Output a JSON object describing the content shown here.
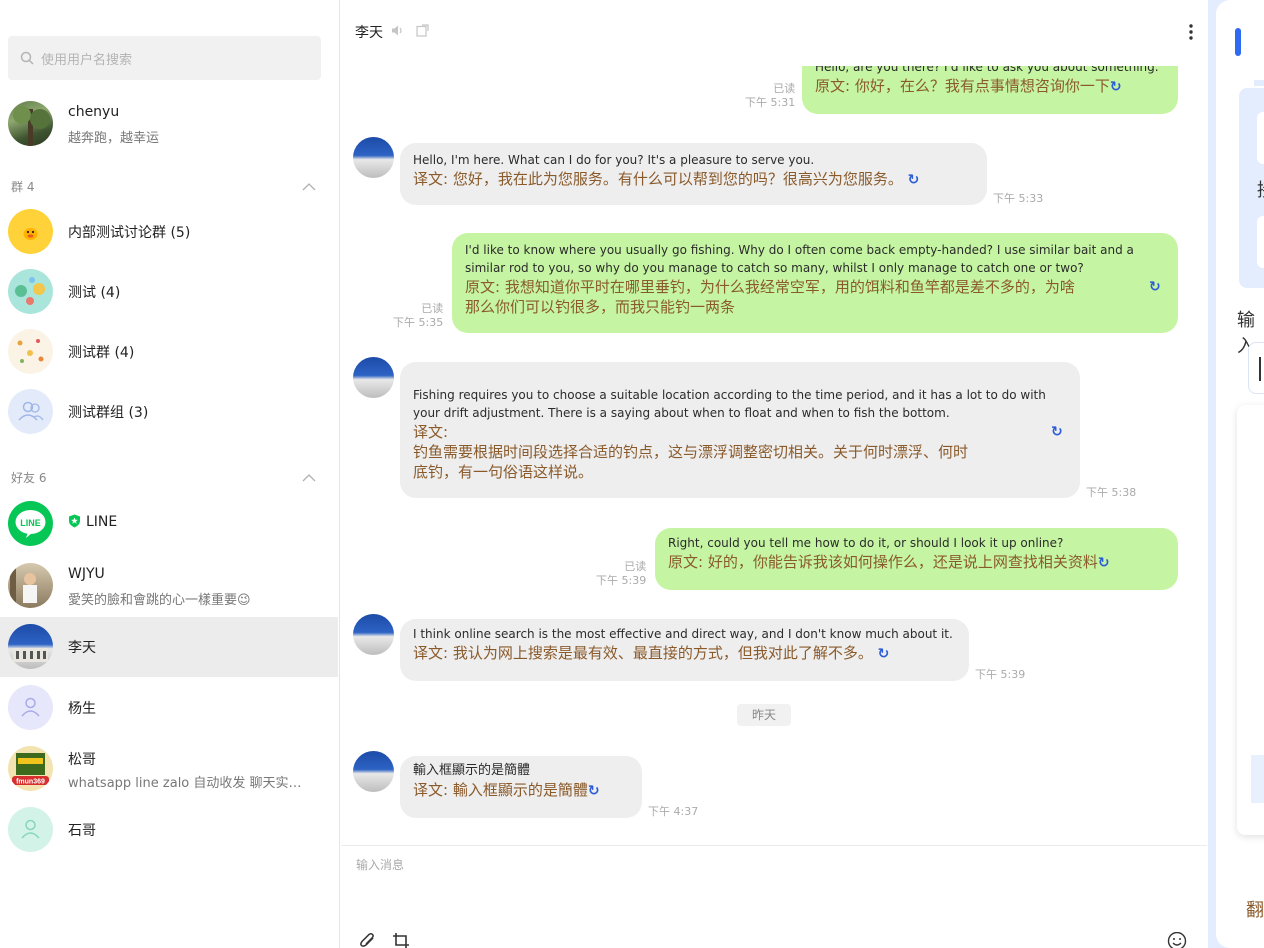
{
  "sidebar": {
    "search_placeholder": "使用用户名搜索",
    "top_contact": {
      "name": "chenyu",
      "status": "越奔跑，越幸运"
    },
    "groups_header": "群 4",
    "groups": [
      {
        "name": "内部测试讨论群 (5)"
      },
      {
        "name": "测试 (4)"
      },
      {
        "name": "测试群 (4)"
      },
      {
        "name": "测试群组 (3)"
      }
    ],
    "friends_header": "好友 6",
    "friends": [
      {
        "name": "LINE",
        "status": ""
      },
      {
        "name": "WJYU",
        "status": "愛笑的臉和會跳的心一樣重要😉"
      },
      {
        "name": "李天",
        "status": ""
      },
      {
        "name": "杨生",
        "status": ""
      },
      {
        "name": "松哥",
        "status": "whatsapp line zalo 自动收发 聊天实…"
      },
      {
        "name": "石哥",
        "status": ""
      }
    ],
    "avatar_text_songge": "fmun369"
  },
  "chat": {
    "title": "李天",
    "messages": [
      {
        "dir": "out",
        "en": "Hello, are you there? I'd like to ask you about something.",
        "tr": "原文: 你好，在么？我有点事情想咨询你一下",
        "read": "已读",
        "time": "下午 5:31"
      },
      {
        "dir": "in",
        "en": "Hello, I'm here. What can I do for you? It's a pleasure to serve you.",
        "tr": "译文: 您好，我在此为您服务。有什么可以帮到您的吗？很高兴为您服务。",
        "time": "下午 5:33"
      },
      {
        "dir": "out",
        "en1": "I'd like to know where you usually go fishing. Why do I often come back empty-handed? I use similar bait and a",
        "en2": "similar rod to you, so why do you manage to catch so many, whilst I only manage to catch one or two?",
        "tr1": "原文: 我想知道你平时在哪里垂钓，为什么我经常空军，用的饵料和鱼竿都是差不多的，为啥",
        "tr2": "那么你们可以钓很多，而我只能钓一两条",
        "read": "已读",
        "time": "下午 5:35"
      },
      {
        "dir": "in",
        "en1": "Fishing requires you to choose a suitable location according to the time period, and it has a lot to do with",
        "en2": "your drift adjustment. There is a saying about when to float and when to fish the bottom.",
        "tr0": "译文:",
        "tr1": "钓鱼需要根据时间段选择合适的钓点，这与漂浮调整密切相关。关于何时漂浮、何时",
        "tr2": "底钓，有一句俗语这样说。",
        "time": "下午 5:38"
      },
      {
        "dir": "out",
        "en": "Right, could you tell me how to do it, or should I look it up online?",
        "tr": "原文: 好的，你能告诉我该如何操作么，还是说上网查找相关资料",
        "read": "已读",
        "time": "下午 5:39"
      },
      {
        "dir": "in",
        "en": "I think online search is the most effective and direct way, and I don't know much about it.",
        "tr": "译文: 我认为网上搜索是最有效、最直接的方式，但我对此了解不多。",
        "time": "下午 5:39"
      },
      {
        "dir": "in",
        "en": "輸入框顯示的是簡體",
        "tr": "译文: 輸入框顯示的是簡體",
        "time": "下午 4:37"
      }
    ],
    "day_separator": "昨天",
    "input_placeholder": "输入消息"
  },
  "right_panel": {
    "fragments": [
      "接",
      "输入",
      "翻"
    ]
  },
  "colors": {
    "out_bubble": "#c5f5a2",
    "in_bubble": "#eeeeee",
    "translation_text": "#8a5a2b",
    "refresh_icon": "#2c5bd6",
    "line_green": "#06c755",
    "right_panel_bg": "#e3edfd",
    "accent_blue": "#2f6bf2"
  }
}
